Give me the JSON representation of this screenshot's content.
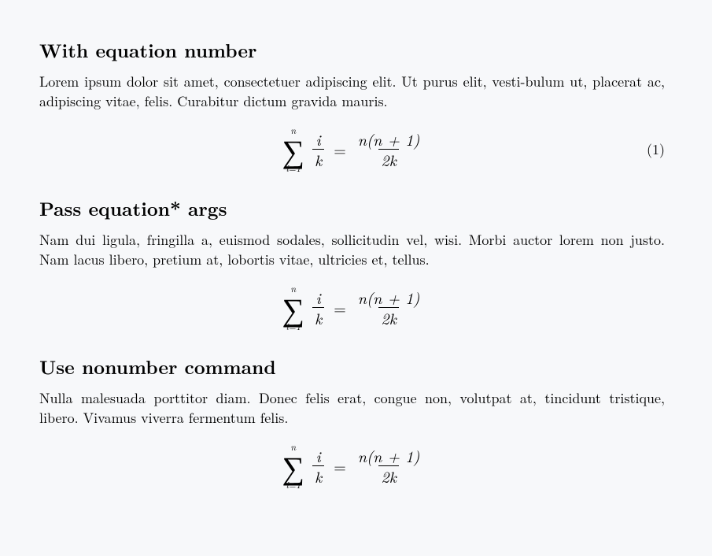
{
  "section1": {
    "heading": "With equation number",
    "paragraph": "Lorem ipsum dolor sit amet, consectetuer adipiscing elit. Ut purus elit, vesti-bulum ut, placerat ac, adipiscing vitae, felis. Curabitur dictum gravida mauris.",
    "eq": {
      "sum_top": "n",
      "sum_bot": "i=1",
      "lhs_num": "i",
      "lhs_den": "k",
      "equals": "=",
      "rhs_num": "n(n + 1)",
      "rhs_den": "2k",
      "number": "(1)"
    }
  },
  "section2": {
    "heading": "Pass equation* args",
    "paragraph": "Nam dui ligula, fringilla a, euismod sodales, sollicitudin vel, wisi. Morbi auctor lorem non justo. Nam lacus libero, pretium at, lobortis vitae, ultricies et, tellus.",
    "eq": {
      "sum_top": "n",
      "sum_bot": "i=1",
      "lhs_num": "i",
      "lhs_den": "k",
      "equals": "=",
      "rhs_num": "n(n + 1)",
      "rhs_den": "2k"
    }
  },
  "section3": {
    "heading": "Use nonumber command",
    "paragraph": "Nulla malesuada porttitor diam. Donec felis erat, congue non, volutpat at, tincidunt tristique, libero. Vivamus viverra fermentum felis.",
    "eq": {
      "sum_top": "n",
      "sum_bot": "i=1",
      "lhs_num": "i",
      "lhs_den": "k",
      "equals": "=",
      "rhs_num": "n(n + 1)",
      "rhs_den": "2k"
    }
  }
}
